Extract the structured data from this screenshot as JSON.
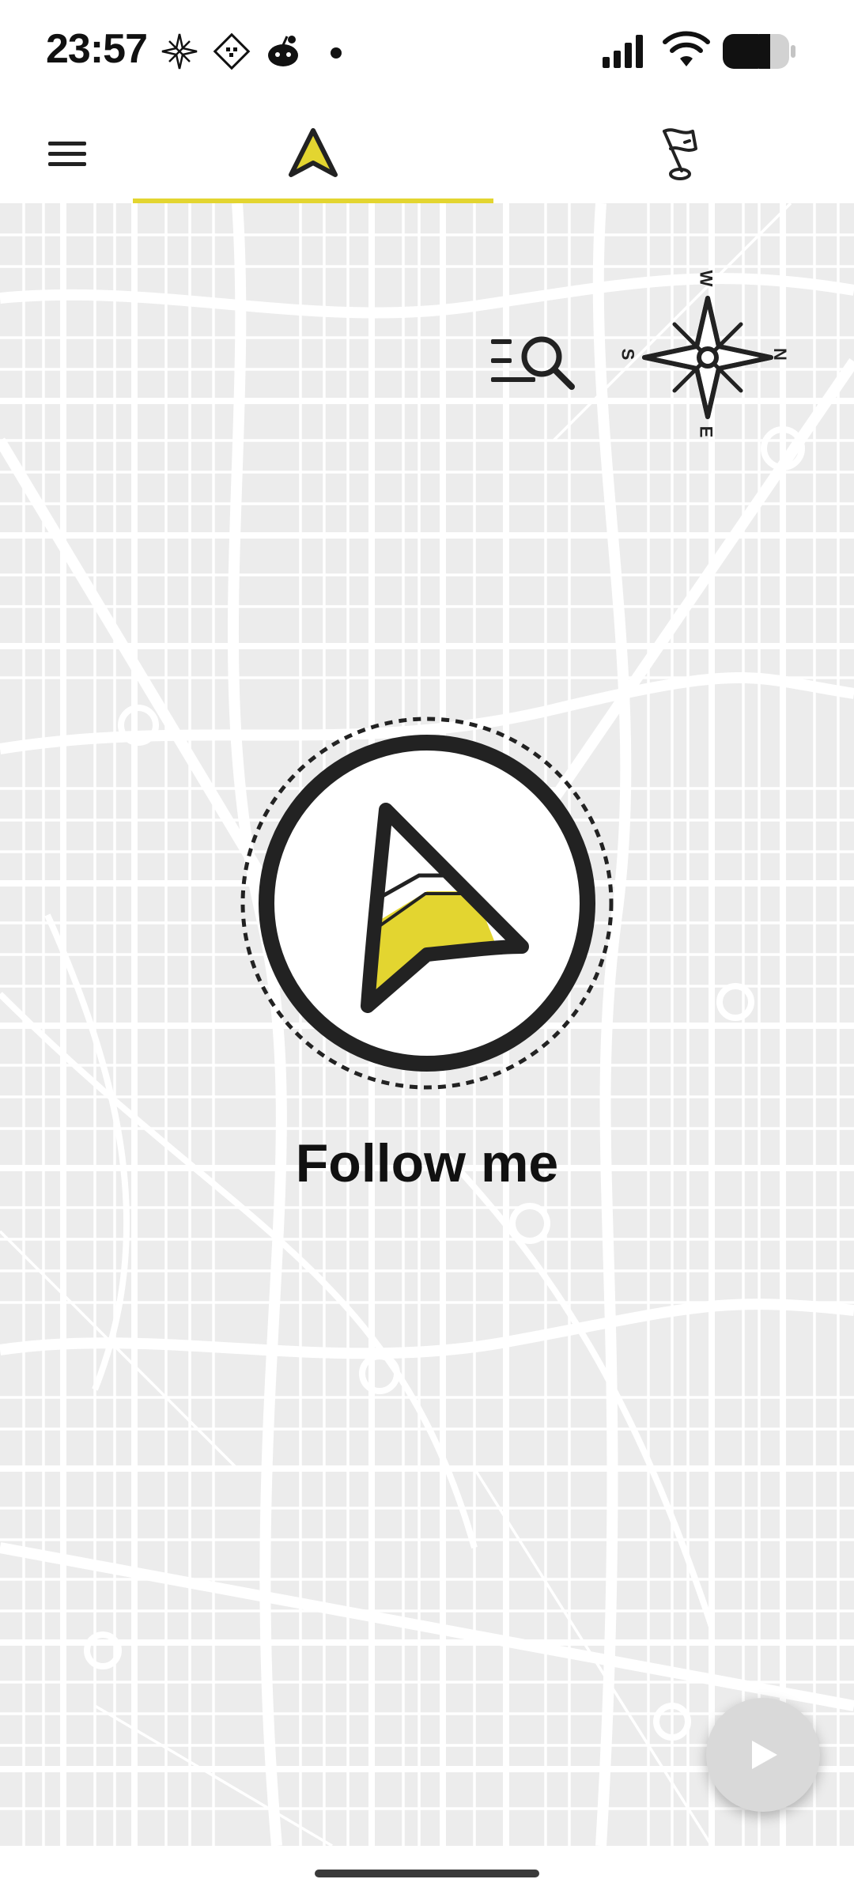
{
  "status_bar": {
    "time": "23:57",
    "notification_icons": [
      "compass-rose-icon",
      "map-pattern-icon",
      "reddit-icon",
      "dot-icon"
    ],
    "right_icons": [
      "cellular-signal-icon",
      "wifi-icon",
      "battery-icon"
    ]
  },
  "toolbar": {
    "menu_icon": "hamburger-menu-icon",
    "tabs": [
      {
        "icon": "navigation-arrow-icon",
        "active": true
      },
      {
        "icon": "golf-flag-icon",
        "active": false
      }
    ],
    "accent_color": "#e3d530"
  },
  "map": {
    "search_icon": "list-search-icon",
    "compass": {
      "north": "N",
      "south": "S",
      "east": "E",
      "west": "W"
    },
    "follow_label": "Follow me",
    "play_icon": "play-icon"
  },
  "colors": {
    "map_background": "#ececec",
    "map_roads": "#ffffff",
    "accent_yellow": "#e3d530",
    "ink": "#222222",
    "play_button": "#d9d9d9"
  }
}
